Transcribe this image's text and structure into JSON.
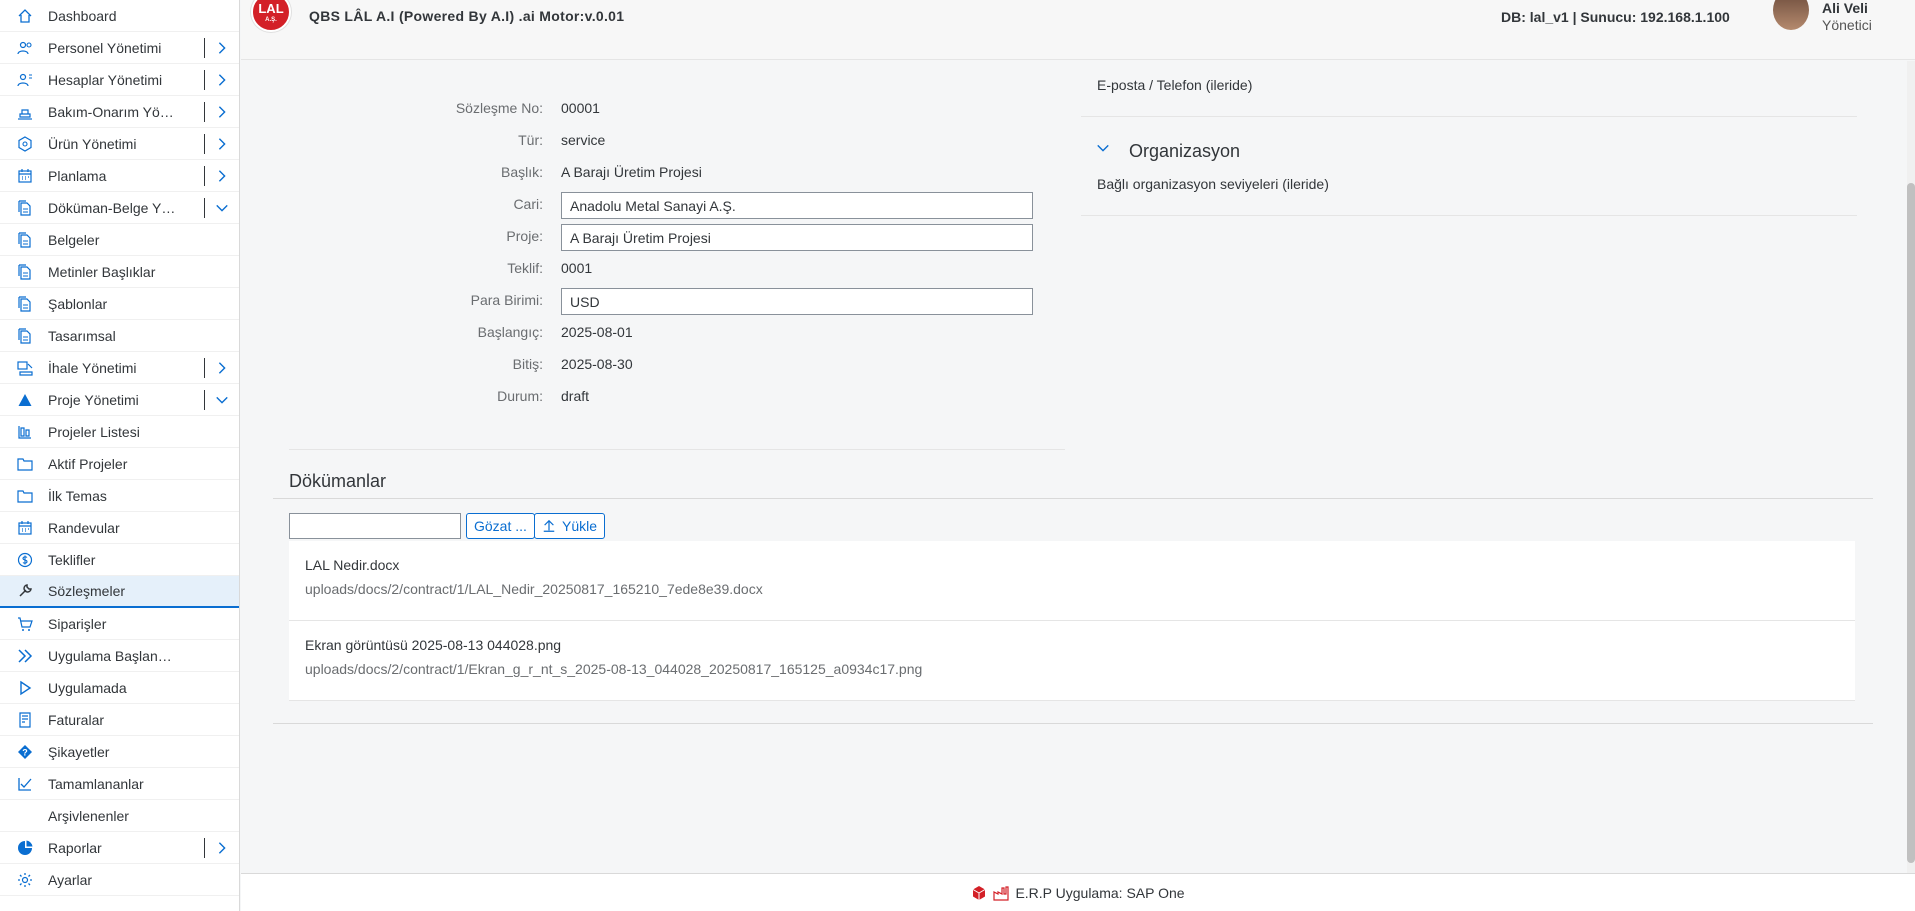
{
  "header": {
    "logo_text": "LAL",
    "logo_sub": "A.Ş.",
    "app_title": "QBS LÂL A.I (Powered By A.I) .ai Motor:v.0.01",
    "db_info": "DB: lal_v1 | Sunucu: 192.168.1.100",
    "user_name": "Ali Veli",
    "user_role": "Yönetici"
  },
  "sidebar": {
    "items": [
      {
        "label": "Dashboard",
        "icon": "home-icon",
        "expander": ""
      },
      {
        "label": "Personel Yönetimi",
        "icon": "people-icon",
        "expander": "right"
      },
      {
        "label": "Hesaplar Yönetimi",
        "icon": "accounts-icon",
        "expander": "right"
      },
      {
        "label": "Bakım-Onarım Yöneti...",
        "icon": "maintenance-icon",
        "expander": "right"
      },
      {
        "label": "Ürün Yönetimi",
        "icon": "product-icon",
        "expander": "right"
      },
      {
        "label": "Planlama",
        "icon": "calendar-icon",
        "expander": "right"
      },
      {
        "label": "Döküman-Belge Yön...",
        "icon": "document-icon",
        "expander": "down"
      },
      {
        "label": "Belgeler",
        "icon": "document-icon",
        "expander": ""
      },
      {
        "label": "Metinler Başlıklar",
        "icon": "document-icon",
        "expander": ""
      },
      {
        "label": "Şablonlar",
        "icon": "document-icon",
        "expander": ""
      },
      {
        "label": "Tasarımsal",
        "icon": "document-icon",
        "expander": ""
      },
      {
        "label": "İhale Yönetimi",
        "icon": "auction-icon",
        "expander": "right"
      },
      {
        "label": "Proje Yönetimi",
        "icon": "triangle-icon",
        "expander": "down"
      },
      {
        "label": "Projeler Listesi",
        "icon": "list-icon",
        "expander": ""
      },
      {
        "label": "Aktif Projeler",
        "icon": "folder-icon",
        "expander": ""
      },
      {
        "label": "İlk Temas",
        "icon": "folder-icon",
        "expander": ""
      },
      {
        "label": "Randevular",
        "icon": "calendar-icon",
        "expander": ""
      },
      {
        "label": "Teklifler",
        "icon": "dollar-icon",
        "expander": ""
      },
      {
        "label": "Sözleşmeler",
        "icon": "wrench-icon",
        "expander": "",
        "selected": true
      },
      {
        "label": "Siparişler",
        "icon": "cart-icon",
        "expander": ""
      },
      {
        "label": "Uygulama Başlangıcı",
        "icon": "double-play-icon",
        "expander": ""
      },
      {
        "label": "Uygulamada",
        "icon": "play-icon",
        "expander": ""
      },
      {
        "label": "Faturalar",
        "icon": "invoice-icon",
        "expander": ""
      },
      {
        "label": "Şikayetler",
        "icon": "question-icon",
        "expander": ""
      },
      {
        "label": "Tamamlananlar",
        "icon": "check-icon",
        "expander": ""
      },
      {
        "label": "Arşivlenenler",
        "icon": "",
        "expander": ""
      },
      {
        "label": "Raporlar",
        "icon": "pie-icon",
        "expander": "right"
      },
      {
        "label": "Ayarlar",
        "icon": "gear-icon",
        "expander": ""
      }
    ]
  },
  "form": {
    "contract_no_label": "Sözleşme No:",
    "contract_no": "00001",
    "type_label": "Tür:",
    "type": "service",
    "title_label": "Başlık:",
    "title": "A Barajı Üretim Projesi",
    "account_label": "Cari:",
    "account": "Anadolu Metal Sanayi A.Ş.",
    "project_label": "Proje:",
    "project": "A Barajı Üretim Projesi",
    "offer_label": "Teklif:",
    "offer": "0001",
    "currency_label": "Para Birimi:",
    "currency": "USD",
    "start_label": "Başlangıç:",
    "start": "2025-08-01",
    "end_label": "Bitiş:",
    "end": "2025-08-30",
    "status_label": "Durum:",
    "status": "draft"
  },
  "right_panel": {
    "contact_text": "E-posta / Telefon (ileride)",
    "org_title": "Organizasyon",
    "org_text": "Bağlı organizasyon seviyeleri (ileride)"
  },
  "documents": {
    "title": "Dökümanlar",
    "browse_label": "Gözat ...",
    "upload_label": "Yükle",
    "items": [
      {
        "name": "LAL Nedir.docx",
        "path": "uploads/docs/2/contract/1/LAL_Nedir_20250817_165210_7ede8e39.docx"
      },
      {
        "name": "Ekran görüntüsü 2025-08-13 044028.png",
        "path": "uploads/docs/2/contract/1/Ekran_g_r_nt_s_2025-08-13_044028_20250817_165125_a0934c17.png"
      }
    ]
  },
  "footer": {
    "text": "E.R.P Uygulama: SAP One"
  }
}
